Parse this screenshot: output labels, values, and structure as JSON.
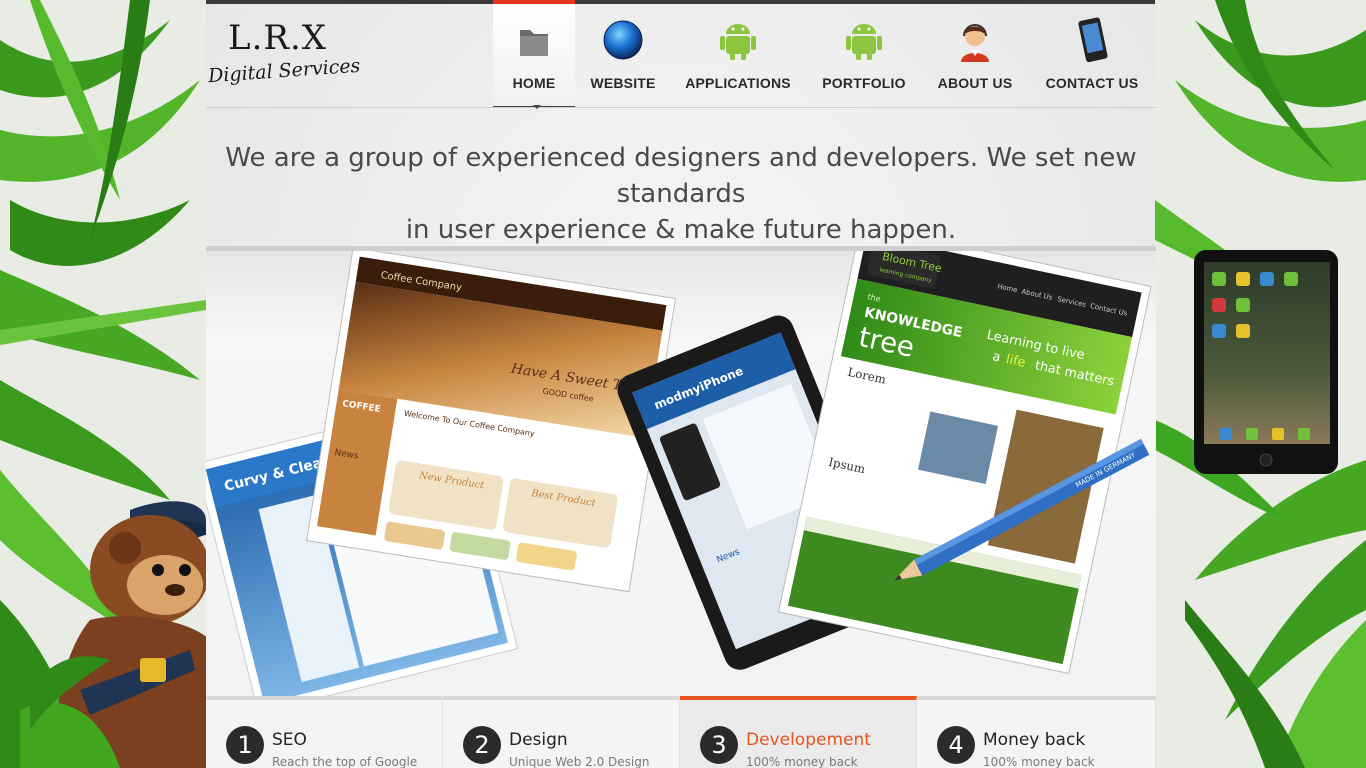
{
  "logo": {
    "title": "L.R.X",
    "subtitle": "Digital Services"
  },
  "nav": {
    "items": [
      {
        "label": "HOME",
        "icon": "folder-icon",
        "active": true
      },
      {
        "label": "WEBSITE",
        "icon": "globe-icon"
      },
      {
        "label": "APPLICATIONS",
        "icon": "android-icon"
      },
      {
        "label": "PORTFOLIO",
        "icon": "android-icon"
      },
      {
        "label": "ABOUT US",
        "icon": "support-person-icon"
      },
      {
        "label": "CONTACT US",
        "icon": "phone-icon"
      }
    ]
  },
  "tagline": {
    "line1": "We are a group of experienced designers and developers. We set new standards",
    "line2": "in user experience & make future happen."
  },
  "showcase": {
    "coffee_site": {
      "brand": "Coffee Company",
      "headline": "Have A Sweet Time!",
      "sub": "GOOD coffee",
      "welcome": "Welcome To Our Coffee Company",
      "news": "News",
      "new_product": "New Product",
      "best_product": "Best Product",
      "side_title": "COFFEE"
    },
    "curvy_site": {
      "title": "Curvy & Clean"
    },
    "phone_site": {
      "title": "modmyiPhone",
      "news": "News"
    },
    "tree_site": {
      "brand": "Bloom Tree",
      "brand_sub": "learning company",
      "top": "the",
      "title1": "KNOWLEDGE",
      "title2": "tree",
      "slogan1": "Learning to live",
      "slogan2": "a",
      "slogan3": "life",
      "slogan4": "that matters",
      "lorem": "Lorem",
      "ipsum": "Ipsum",
      "nav": [
        "Home",
        "About Us",
        "Services",
        "Contact Us"
      ]
    },
    "pencil_text": "MADE IN GERMANY"
  },
  "features": [
    {
      "num": "1",
      "title": "SEO",
      "sub": "Reach the top of Google"
    },
    {
      "num": "2",
      "title": "Design",
      "sub": "Unique Web 2.0 Design"
    },
    {
      "num": "3",
      "title": "Developement",
      "sub": "100% money back",
      "active": true
    },
    {
      "num": "4",
      "title": "Money back",
      "sub": "100% money back"
    }
  ],
  "colors": {
    "accent": "#e53521",
    "active_feature": "#e8531f",
    "leaf_green": "#3daa1f"
  }
}
